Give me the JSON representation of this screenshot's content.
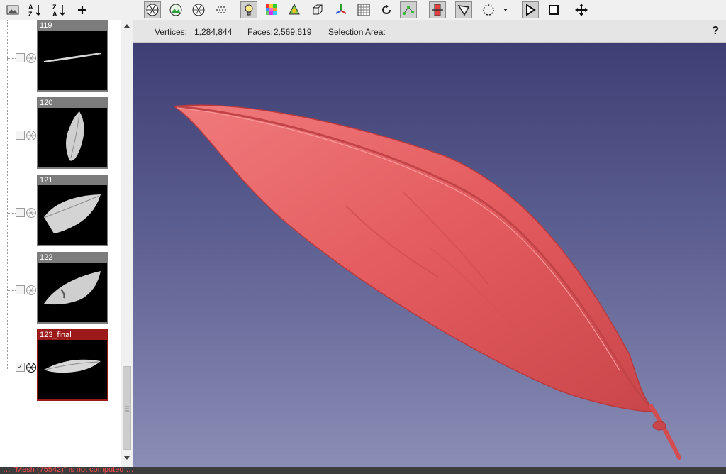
{
  "toolbar": {
    "icons": [
      "image-icon",
      "sort-ascending-icon",
      "sort-descending-icon",
      "add-icon",
      "show-all-icon",
      "snapshot-icon",
      "mesh-icon",
      "points-icon",
      "light-icon",
      "color-grid-icon",
      "vertex-color-icon",
      "bounding-box-icon",
      "axes-icon",
      "texture-icon",
      "rotate-icon",
      "pick-points-icon",
      "align-icon",
      "select-faces-icon",
      "lasso-icon",
      "circle-select-icon",
      "dropdown-icon",
      "play-icon",
      "stop-icon",
      "move-icon"
    ]
  },
  "layers": [
    {
      "name": "119",
      "checked": false,
      "active": false
    },
    {
      "name": "120",
      "checked": false,
      "active": false
    },
    {
      "name": "121",
      "checked": false,
      "active": false
    },
    {
      "name": "122",
      "checked": false,
      "active": false
    },
    {
      "name": "123_final",
      "checked": true,
      "active": true
    }
  ],
  "info": {
    "vertices_label": "Vertices:",
    "vertices_value": "1,284,844",
    "faces_label": "Faces:",
    "faces_value": "2,569,619",
    "selection_label": "Selection Area:",
    "help_label": "?"
  },
  "status": {
    "text": "… \"Mesh (75542)\" is not computed …"
  },
  "colors": {
    "model": "#e8585c",
    "active_layer": "#9c1a1a",
    "viewport_top": "#3a3a70",
    "viewport_bottom": "#8a8db5"
  }
}
